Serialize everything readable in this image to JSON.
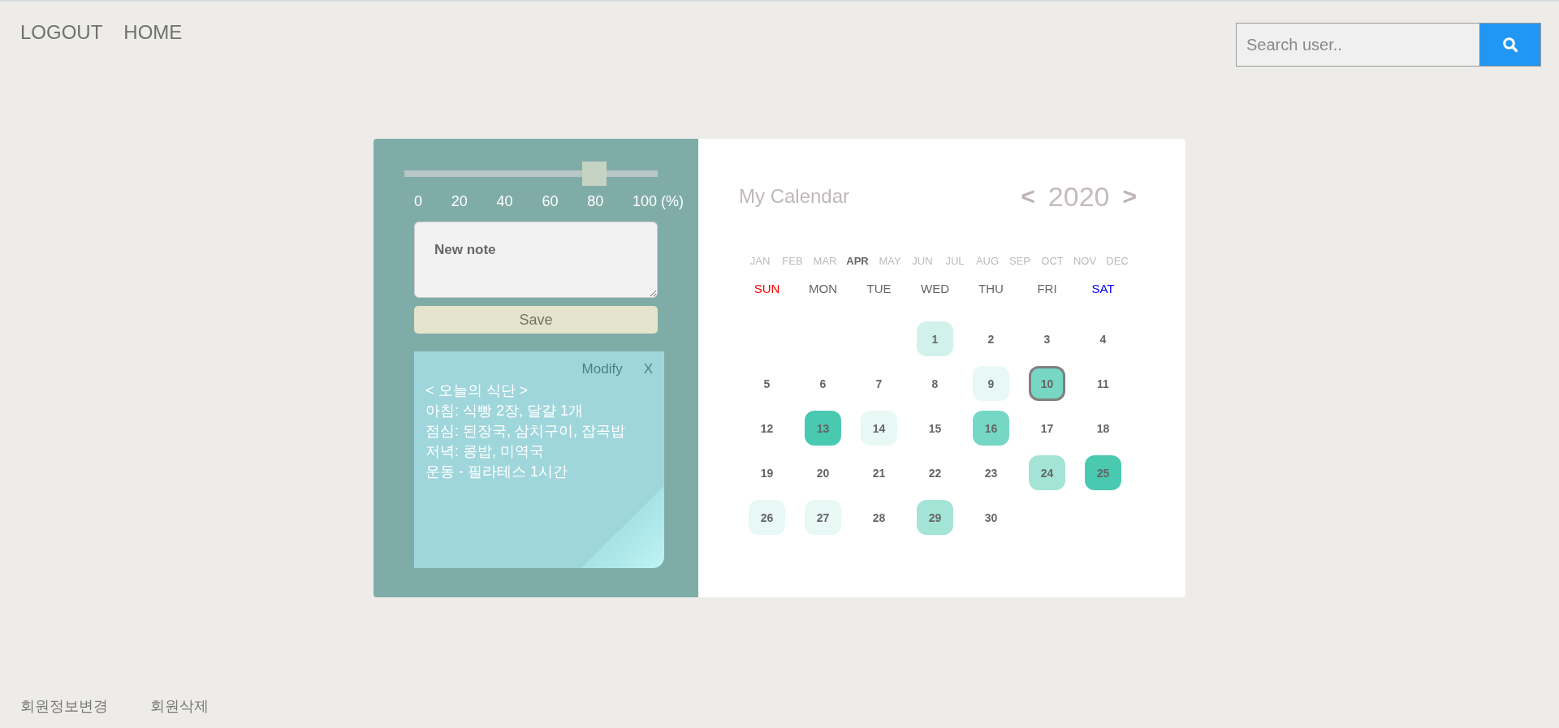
{
  "nav": {
    "links": [
      "LOGOUT",
      "HOME"
    ]
  },
  "search": {
    "placeholder": "Search user.."
  },
  "editor": {
    "slider": {
      "level": 0.75,
      "ticks": [
        "0",
        "20",
        "40",
        "60",
        "80",
        "100 (%)"
      ]
    },
    "note_field": {
      "placeholder": "New note"
    },
    "save_button": "Save"
  },
  "sticky_note": {
    "actions": [
      "Modify",
      "X"
    ],
    "lines": [
      "< 오늘의 식단 >",
      "아침: 식빵 2장, 달걀 1개",
      "점심: 된장국, 삼치구이, 잡곡밥",
      "저녁: 콩밥, 미역국",
      "운동 - 필라테스 1시간"
    ]
  },
  "calendar": {
    "title": "My Calendar",
    "prev": "<",
    "year": "2020",
    "next": ">",
    "months": [
      {
        "label": "JAN",
        "selected": false
      },
      {
        "label": "FEB",
        "selected": false
      },
      {
        "label": "MAR",
        "selected": false
      },
      {
        "label": "APR",
        "selected": true
      },
      {
        "label": "MAY",
        "selected": false
      },
      {
        "label": "JUN",
        "selected": false
      },
      {
        "label": "JUL",
        "selected": false
      },
      {
        "label": "AUG",
        "selected": false
      },
      {
        "label": "SEP",
        "selected": false
      },
      {
        "label": "OCT",
        "selected": false
      },
      {
        "label": "NOV",
        "selected": false
      },
      {
        "label": "DEC",
        "selected": false
      }
    ],
    "weekdays": [
      {
        "label": "SUN",
        "color": "#ff0000"
      },
      {
        "label": "MON",
        "color": "#666666"
      },
      {
        "label": "TUE",
        "color": "#666666"
      },
      {
        "label": "WED",
        "color": "#666666"
      },
      {
        "label": "THU",
        "color": "#666666"
      },
      {
        "label": "FRI",
        "color": "#666666"
      },
      {
        "label": "SAT",
        "color": "#0000ff"
      }
    ],
    "weeks": [
      [
        {
          "day": "1",
          "color": "#d1f2eb",
          "selected": false
        },
        {
          "day": "2",
          "selected": false
        },
        {
          "day": "3",
          "selected": false
        },
        {
          "day": "4",
          "selected": false
        }
      ],
      [
        {
          "day": "5",
          "selected": false
        },
        {
          "day": "6",
          "selected": false
        },
        {
          "day": "7",
          "selected": false
        },
        {
          "day": "8",
          "selected": false
        },
        {
          "day": "9",
          "color": "#e8f8f5",
          "selected": false
        },
        {
          "day": "10",
          "color": "#76d7c4",
          "selected": true
        },
        {
          "day": "11",
          "selected": false
        }
      ],
      [
        {
          "day": "12",
          "selected": false
        },
        {
          "day": "13",
          "color": "#48c9b0",
          "selected": false
        },
        {
          "day": "14",
          "color": "#e8f8f5",
          "selected": false
        },
        {
          "day": "15",
          "selected": false
        },
        {
          "day": "16",
          "color": "#76d7c4",
          "selected": false
        },
        {
          "day": "17",
          "selected": false
        },
        {
          "day": "18",
          "selected": false
        }
      ],
      [
        {
          "day": "19",
          "selected": false
        },
        {
          "day": "20",
          "selected": false
        },
        {
          "day": "21",
          "selected": false
        },
        {
          "day": "22",
          "selected": false
        },
        {
          "day": "23",
          "selected": false
        },
        {
          "day": "24",
          "color": "#a3e4d7",
          "selected": false
        },
        {
          "day": "25",
          "color": "#48c9b0",
          "selected": false
        }
      ],
      [
        {
          "day": "26",
          "color": "#e8f8f5",
          "selected": false
        },
        {
          "day": "27",
          "color": "#e8f8f5",
          "selected": false
        },
        {
          "day": "28",
          "selected": false
        },
        {
          "day": "29",
          "color": "#a3e4d7",
          "selected": false
        },
        {
          "day": "30",
          "selected": false
        }
      ]
    ]
  },
  "footer": {
    "links": [
      "회원정보변경",
      "회원삭제"
    ]
  }
}
